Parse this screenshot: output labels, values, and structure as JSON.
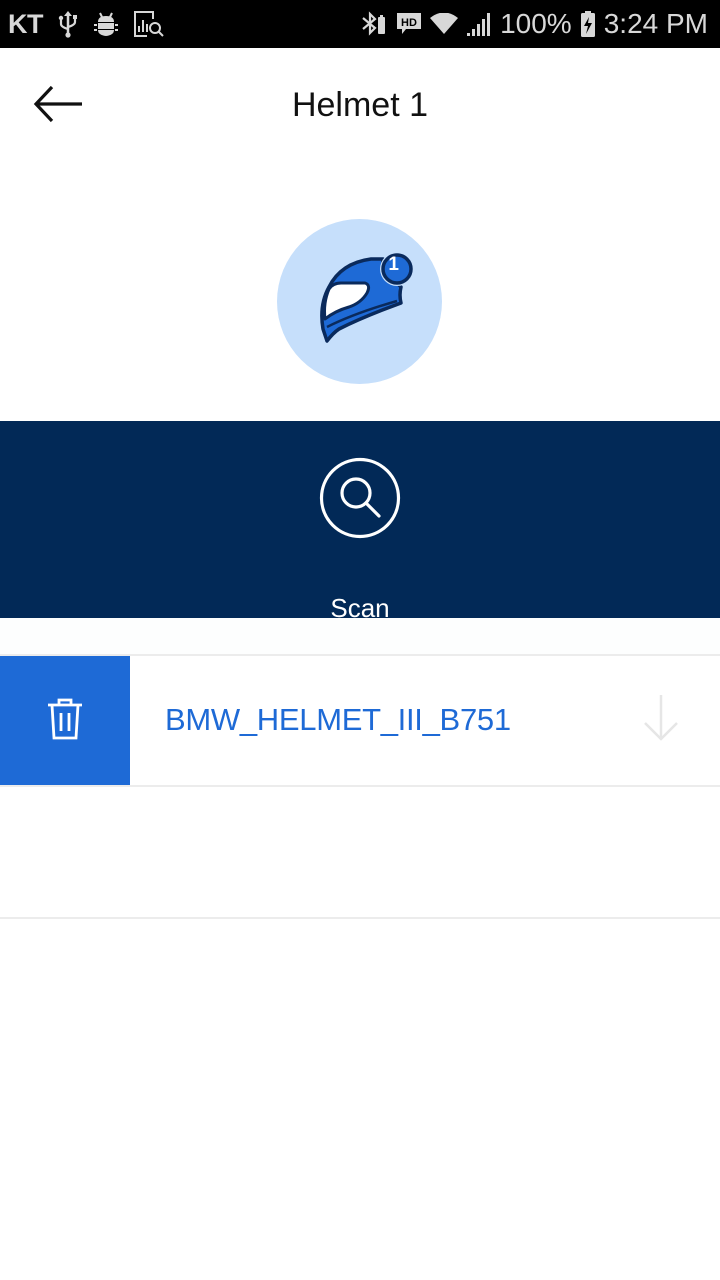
{
  "status_bar": {
    "carrier": "KT",
    "left_icons": [
      "usb-icon",
      "android-debug-icon",
      "data-analysis-icon"
    ],
    "right_icons": [
      "bluetooth-icon",
      "hd-voice-icon",
      "wifi-icon",
      "signal-icon",
      "battery-charging-icon"
    ],
    "battery_percent": "100%",
    "time": "3:24 PM"
  },
  "header": {
    "back_icon": "arrow-left-icon",
    "title": "Helmet 1"
  },
  "avatar": {
    "icon": "helmet-icon",
    "badge_number": "1",
    "colors": {
      "circle_bg": "#c6dffb",
      "helmet_fill": "#1e6ad6",
      "outline": "#0a2a5c"
    }
  },
  "scan": {
    "icon": "search-icon",
    "label": "Scan",
    "bg_color": "#022957"
  },
  "devices": [
    {
      "name": "BMW_HELMET_III_B751",
      "delete_icon": "trash-icon",
      "action_icon": "arrow-down-icon"
    }
  ],
  "colors": {
    "accent": "#1e6ad6",
    "divider": "#ececec"
  }
}
